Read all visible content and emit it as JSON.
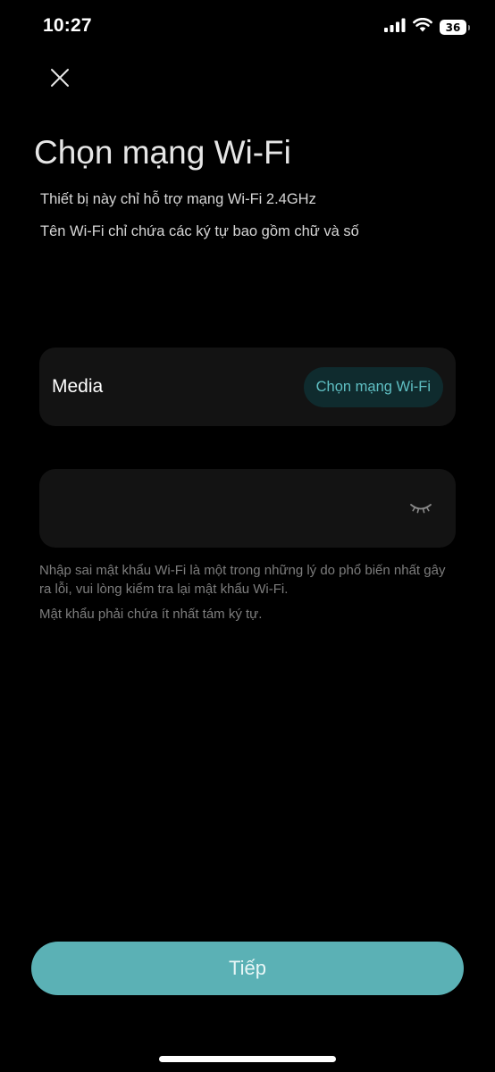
{
  "status_bar": {
    "time": "10:27",
    "battery_level": "36",
    "icons": [
      "cellular-signal-icon",
      "wifi-icon",
      "battery-icon"
    ]
  },
  "header": {
    "close_icon": "close-icon",
    "title": "Chọn mạng Wi-Fi",
    "subtitle_1": "Thiết bị này chỉ hỗ trợ mạng Wi-Fi 2.4GHz",
    "subtitle_2": "Tên Wi-Fi chỉ chứa các ký tự bao gồm chữ và số"
  },
  "network": {
    "name": "Media",
    "choose_label": "Chọn mạng Wi-Fi"
  },
  "password": {
    "value": "",
    "placeholder": "",
    "toggle_icon": "eye-closed-icon"
  },
  "help": {
    "line_1": "Nhập sai mật khẩu Wi-Fi là một trong những lý do phổ biến nhất gây ra lỗi, vui lòng kiểm tra lại mật khẩu Wi-Fi.",
    "line_2": "Mật khẩu phải chứa ít nhất tám ký tự."
  },
  "footer": {
    "next_label": "Tiếp"
  },
  "colors": {
    "background": "#000000",
    "card": "#131313",
    "accent": "#5bb1b5",
    "accent_text": "#5fbfc3",
    "chip_bg": "#0f2b2e",
    "muted_text": "#7d7d7d"
  }
}
